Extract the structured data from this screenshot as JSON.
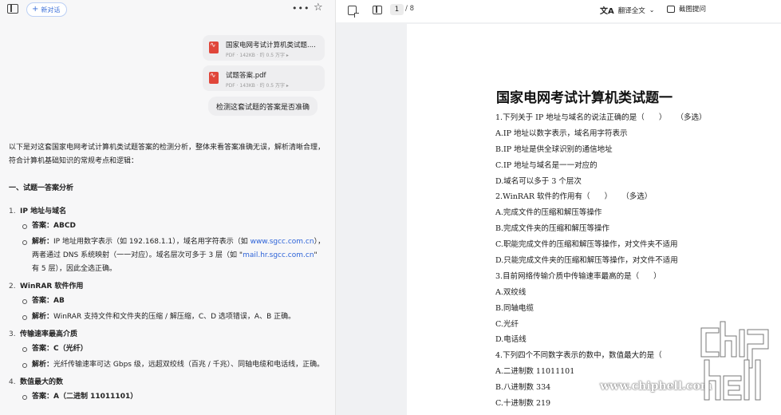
{
  "chat": {
    "new_chat_label": "新对话",
    "files": [
      {
        "name": "国家电网考试计算机类试题....",
        "meta": "PDF · 142KB · 约 0.5 万字 ▸"
      },
      {
        "name": "试题答案.pdf",
        "meta": "PDF · 143KB · 约 0.5 万字 ▸"
      }
    ],
    "user_message": "检测这套试题的答案是否准确",
    "answer": {
      "intro": "以下是对这套国家电网考试计算机类试题答案的检测分析，整体来看答案准确无误，解析清晰合理，符合计算机基础知识的常规考点和逻辑：",
      "section_title": "一、试题一答案分析",
      "q1": {
        "num": "1.",
        "title": "IP 地址与域名",
        "ans_label": "答案：",
        "ans_value": "ABCD",
        "exp_label": "解析：",
        "exp_a": "IP 地址用数字表示（如 192.168.1.1），域名用字符表示（如 ",
        "exp_link1": "www.sgcc.com.cn",
        "exp_b": "），两者通过 DNS 系统映射（一一对应）。域名层次可多于 3 层（如 \"",
        "exp_link2": "mail.hr.sgcc.com.cn",
        "exp_c": "\" 有 5 层），因此全选正确。"
      },
      "q2": {
        "num": "2.",
        "title": "WinRAR 软件作用",
        "ans_label": "答案：",
        "ans_value": "AB",
        "exp_label": "解析：",
        "exp": "WinRAR 支持文件和文件夹的压缩 / 解压缩，C、D 选项错误，A、B 正确。"
      },
      "q3": {
        "num": "3.",
        "title": "传输速率最高介质",
        "ans_label": "答案：",
        "ans_value": "C（光纤）",
        "exp_label": "解析：",
        "exp": "光纤传输速率可达 Gbps 级，远超双绞线（百兆 / 千兆）、同轴电缆和电话线，正确。"
      },
      "q4": {
        "num": "4.",
        "title": "数值最大的数",
        "ans_label": "答案：",
        "ans_value": "A（二进制 11011101）"
      }
    }
  },
  "viewer": {
    "page_current": "1",
    "page_total": "/ 8",
    "translate_label": "翻译全文",
    "screenshot_label": "截图提问",
    "doc_title": "国家电网考试计算机类试题一",
    "doc_lines": [
      "1.下列关于 IP 地址与域名的说法正确的是（      ）    （多选）",
      "A.IP 地址以数字表示，域名用字符表示",
      "B.IP 地址是供全球识别的通信地址",
      "C.IP 地址与域名是一一对应的",
      "D.域名可以多于 3 个层次",
      "2.WinRAR 软件的作用有（      ）    （多选）",
      "A.完成文件的压缩和解压等操作",
      "B.完成文件夹的压缩和解压等操作",
      "C.职能完成文件的压缩和解压等操作，对文件夹不适用",
      "D.只能完成文件夹的压缩和解压等操作，对文件不适用",
      "3.目前网络传输介质中传输速率最高的是（      ）",
      "A.双绞线",
      "B.同轴电缆",
      "C.光纤",
      "D.电话线",
      "4.下列四个不同数字表示的数中，数值最大的是（",
      "A.二进制数 11011101",
      "B.八进制数 334",
      "C.十进制数 219"
    ]
  },
  "watermark": {
    "url": "www.chiphell.com",
    "logo_text": "chip hell"
  },
  "icons": {
    "sidebar": "sidebar-toggle-icon",
    "more": "more-icon",
    "star": "star-icon",
    "pdf": "pdf-file-icon",
    "new_doc": "new-document-icon",
    "translate": "translate-icon",
    "screenshot": "screenshot-icon"
  }
}
